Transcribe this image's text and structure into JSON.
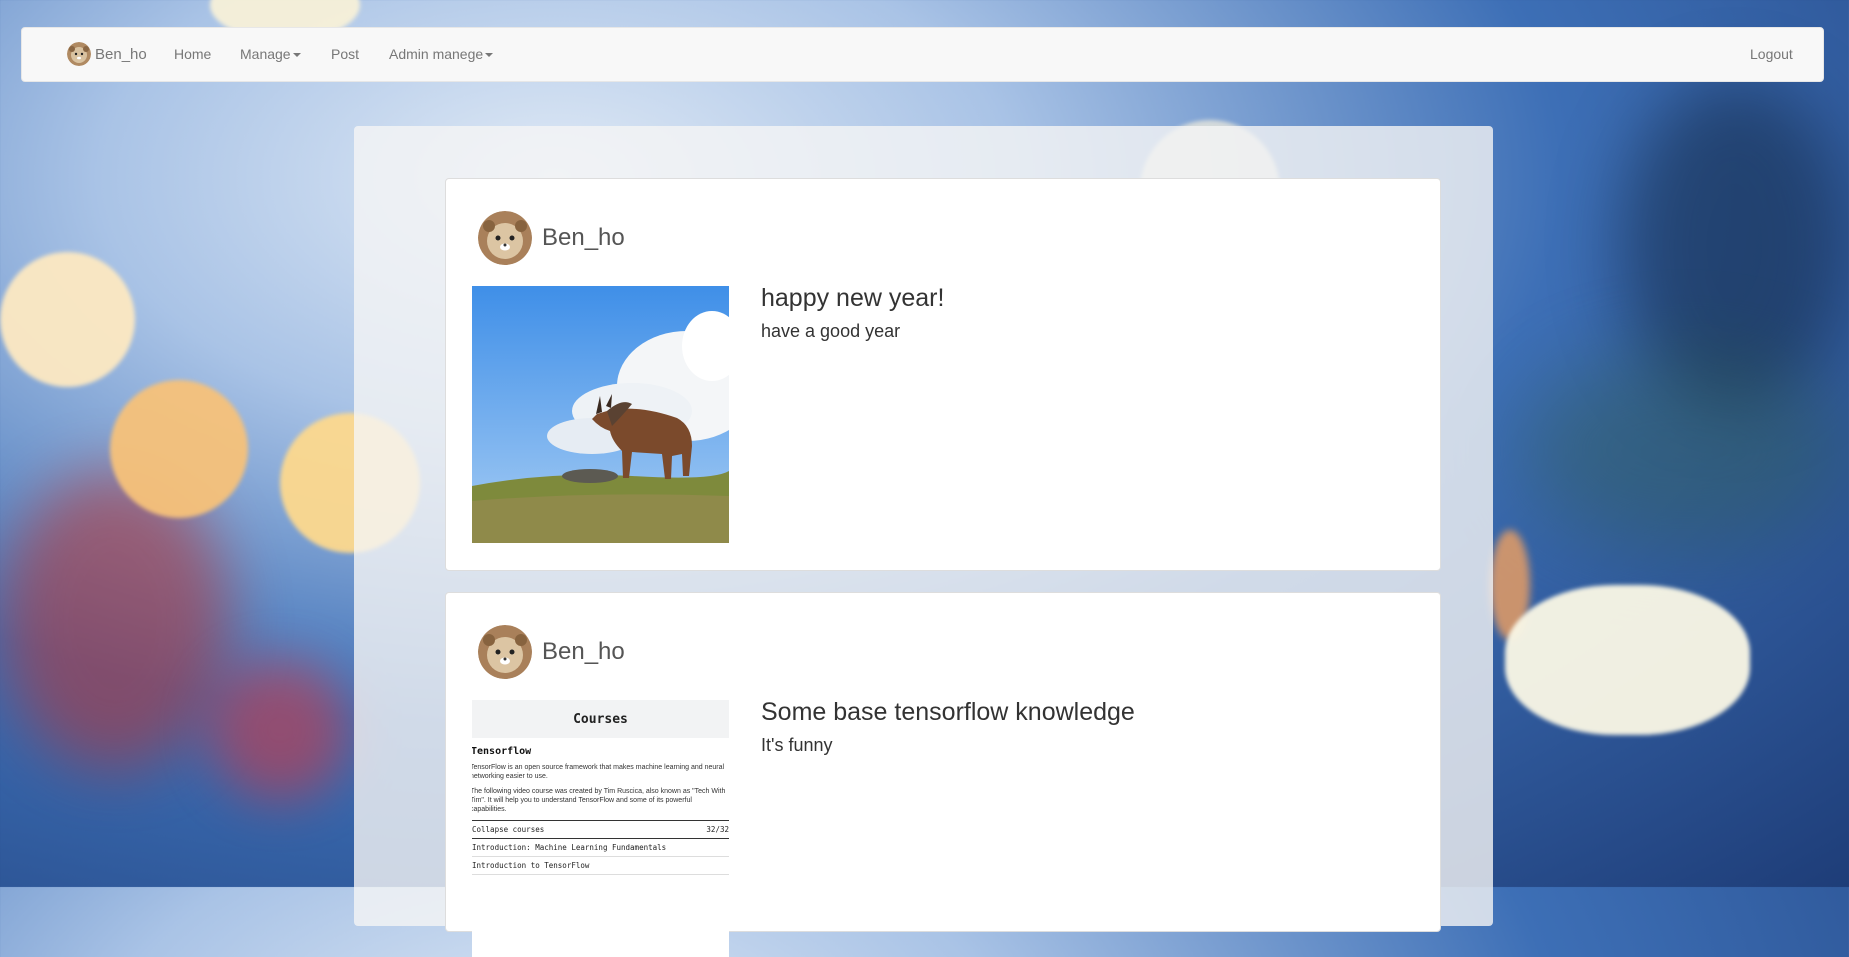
{
  "navbar": {
    "brand": "Ben_ho",
    "items": [
      {
        "label": "Home"
      },
      {
        "label": "Manage"
      },
      {
        "label": "Post"
      },
      {
        "label": "Admin manege"
      }
    ],
    "logout": "Logout"
  },
  "posts": [
    {
      "author": "Ben_ho",
      "title": "happy new year!",
      "body": "have a good year"
    },
    {
      "author": "Ben_ho",
      "title": "Some base tensorflow knowledge",
      "body": "It's funny",
      "thumbnail": {
        "header": "Courses",
        "heading": "Tensorflow",
        "para1": "TensorFlow is an open source framework that makes machine learning and neural networking easier to use.",
        "para2": "The following video course was created by Tim Ruscica, also known as \"Tech With Tim\". It will help you to understand TensorFlow and some of its powerful capabilities.",
        "collapse_label": "Collapse courses",
        "progress": "32/32",
        "lessons": [
          "Introduction: Machine Learning Fundamentals",
          "Introduction to TensorFlow"
        ]
      }
    }
  ]
}
